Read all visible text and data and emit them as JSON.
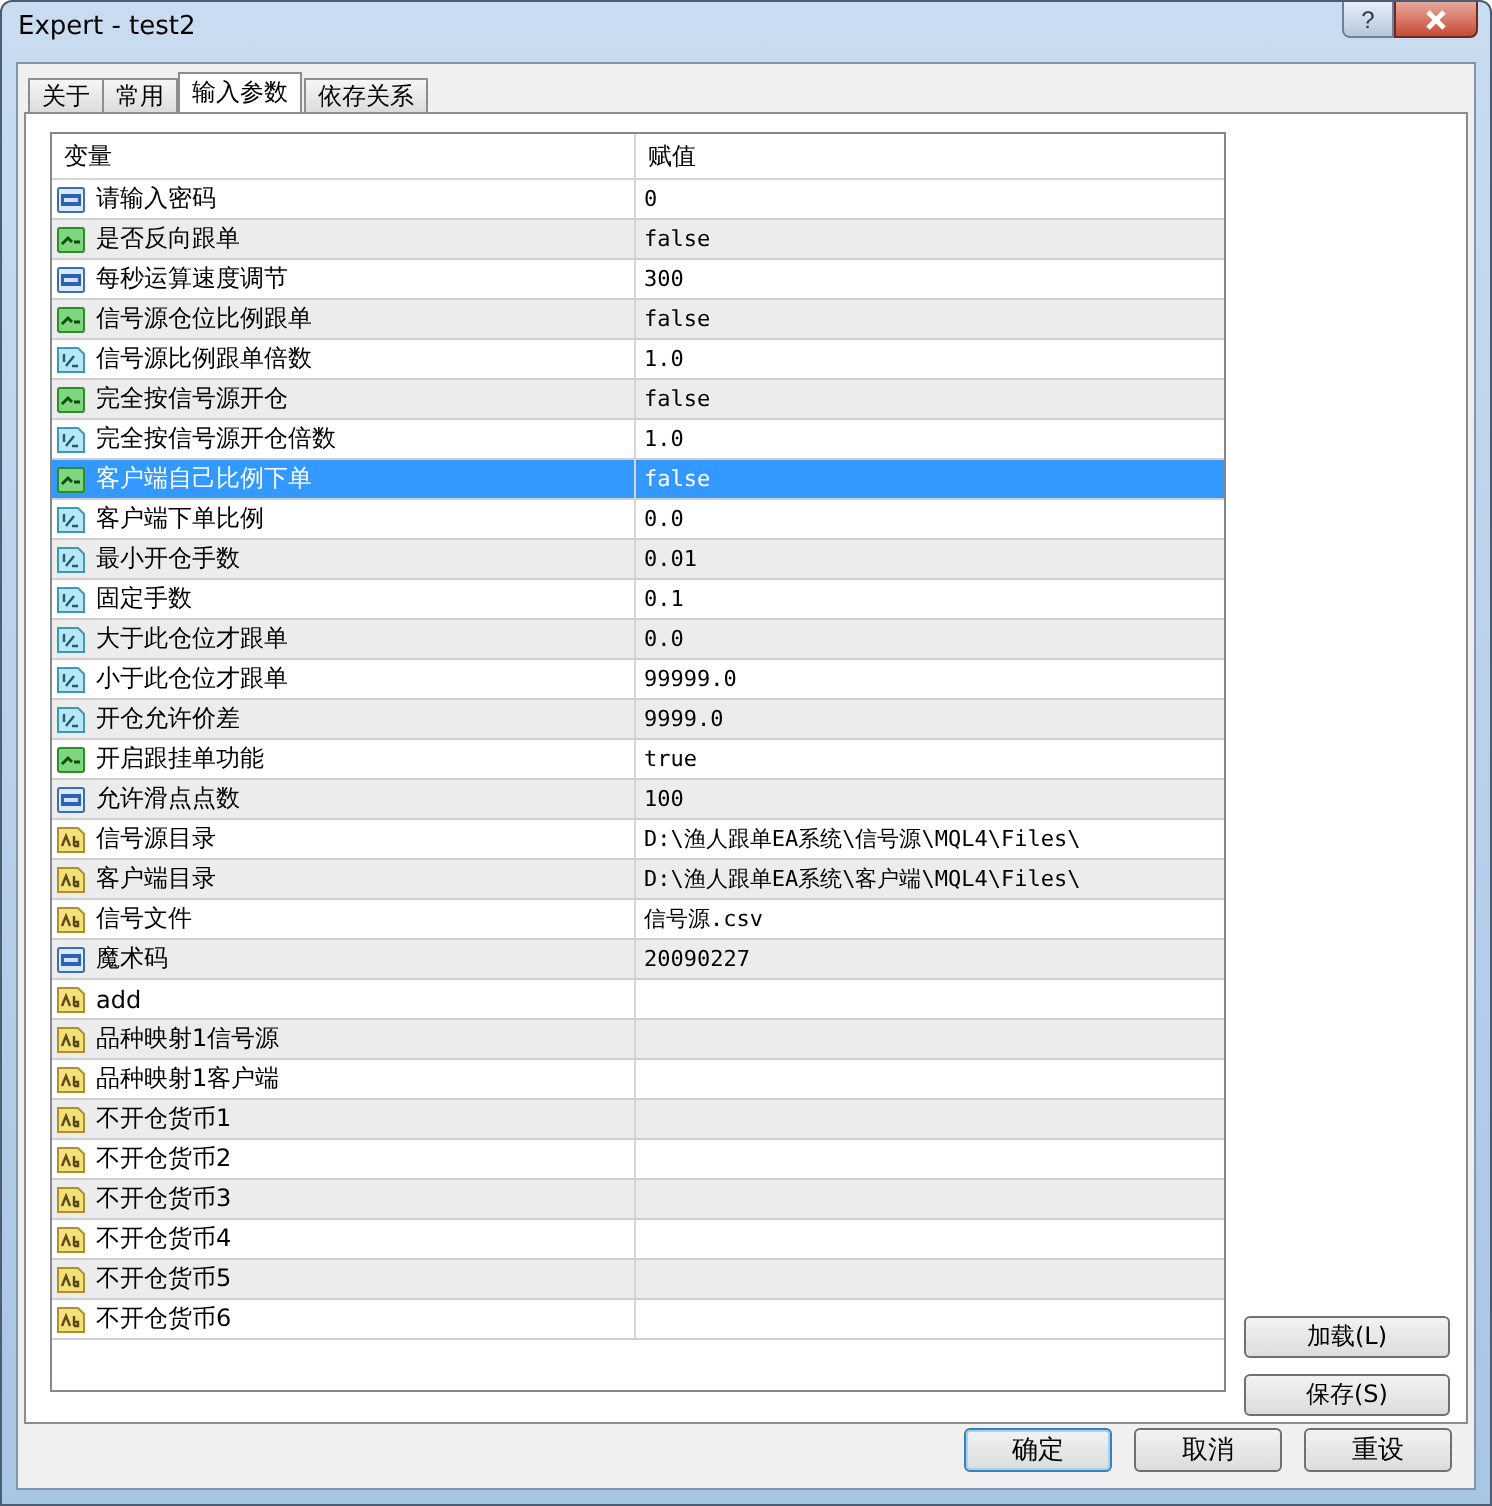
{
  "window": {
    "title": "Expert - test2",
    "help_label": "?"
  },
  "tabs": [
    {
      "label": "关于",
      "selected": false
    },
    {
      "label": "常用",
      "selected": false
    },
    {
      "label": "输入参数",
      "selected": true
    },
    {
      "label": "依存关系",
      "selected": false
    }
  ],
  "table": {
    "columns": [
      "变量",
      "赋值"
    ],
    "rows": [
      {
        "kind": "int",
        "name": "请输入密码",
        "value": "0",
        "selected": false
      },
      {
        "kind": "bool",
        "name": "是否反向跟单",
        "value": "false",
        "selected": false
      },
      {
        "kind": "int",
        "name": "每秒运算速度调节",
        "value": "300",
        "selected": false
      },
      {
        "kind": "bool",
        "name": "信号源仓位比例跟单",
        "value": "false",
        "selected": false
      },
      {
        "kind": "double",
        "name": "信号源比例跟单倍数",
        "value": "1.0",
        "selected": false
      },
      {
        "kind": "bool",
        "name": "完全按信号源开仓",
        "value": "false",
        "selected": false
      },
      {
        "kind": "double",
        "name": "完全按信号源开仓倍数",
        "value": "1.0",
        "selected": false
      },
      {
        "kind": "bool",
        "name": "客户端自己比例下单",
        "value": "false",
        "selected": true
      },
      {
        "kind": "double",
        "name": "客户端下单比例",
        "value": "0.0",
        "selected": false
      },
      {
        "kind": "double",
        "name": "最小开仓手数",
        "value": "0.01",
        "selected": false
      },
      {
        "kind": "double",
        "name": "固定手数",
        "value": "0.1",
        "selected": false
      },
      {
        "kind": "double",
        "name": "大于此仓位才跟单",
        "value": "0.0",
        "selected": false
      },
      {
        "kind": "double",
        "name": "小于此仓位才跟单",
        "value": "99999.0",
        "selected": false
      },
      {
        "kind": "double",
        "name": "开仓允许价差",
        "value": "9999.0",
        "selected": false
      },
      {
        "kind": "bool",
        "name": "开启跟挂单功能",
        "value": "true",
        "selected": false
      },
      {
        "kind": "int",
        "name": "允许滑点点数",
        "value": "100",
        "selected": false
      },
      {
        "kind": "string",
        "name": "信号源目录",
        "value": "D:\\渔人跟单EA系统\\信号源\\MQL4\\Files\\",
        "selected": false
      },
      {
        "kind": "string",
        "name": "客户端目录",
        "value": "D:\\渔人跟单EA系统\\客户端\\MQL4\\Files\\",
        "selected": false
      },
      {
        "kind": "string",
        "name": "信号文件",
        "value": "信号源.csv",
        "selected": false
      },
      {
        "kind": "int",
        "name": "魔术码",
        "value": "20090227",
        "selected": false
      },
      {
        "kind": "string",
        "name": "add",
        "selected": false
      },
      {
        "kind": "string",
        "name": "品种映射1信号源",
        "selected": false
      },
      {
        "kind": "string",
        "name": "品种映射1客户端",
        "selected": false
      },
      {
        "kind": "string",
        "name": "不开仓货币1",
        "selected": false
      },
      {
        "kind": "string",
        "name": "不开仓货币2",
        "selected": false
      },
      {
        "kind": "string",
        "name": "不开仓货币3",
        "selected": false
      },
      {
        "kind": "string",
        "name": "不开仓货币4",
        "selected": false
      },
      {
        "kind": "string",
        "name": "不开仓货币5",
        "selected": false
      },
      {
        "kind": "string",
        "name": "不开仓货币6",
        "selected": false
      }
    ]
  },
  "side_buttons": [
    "加载(L)",
    "保存(S)"
  ],
  "buttons": [
    {
      "label": "确定",
      "default": true
    },
    {
      "label": "取消",
      "default": false
    },
    {
      "label": "重设",
      "default": false
    }
  ]
}
